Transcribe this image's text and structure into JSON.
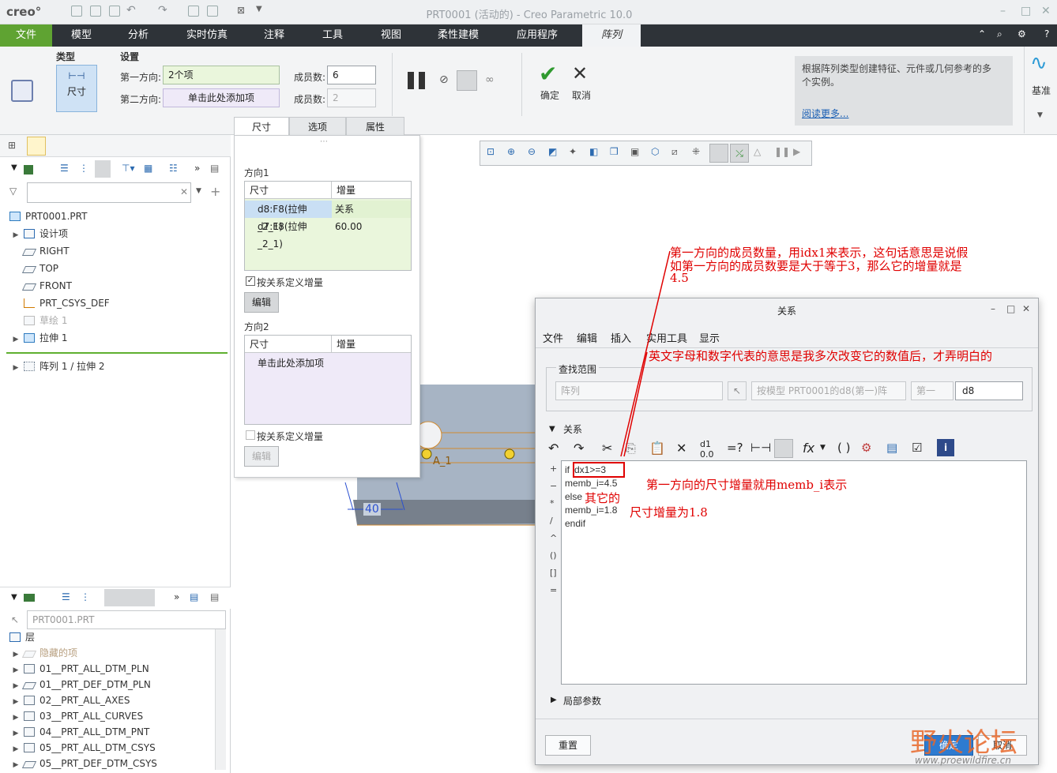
{
  "window": {
    "logo": "creo°",
    "title": "PRT0001 (活动的) - Creo Parametric 10.0"
  },
  "menu": [
    "文件",
    "模型",
    "分析",
    "实时仿真",
    "注释",
    "工具",
    "视图",
    "柔性建模",
    "应用程序",
    "阵列"
  ],
  "ribbon": {
    "type_group": "类型",
    "type_button": "尺寸",
    "settings_group": "设置",
    "dir1_label": "第一方向:",
    "dir1_value": "2个项",
    "dir2_label": "第二方向:",
    "dir2_value": "单击此处添加项",
    "members1_label": "成员数:",
    "members1_value": "6",
    "members2_label": "成员数:",
    "members2_value": "2",
    "ok_label": "确定",
    "cancel_label": "取消",
    "help_text": "根据阵列类型创建特征、元件或几何参考的多个实例。",
    "help_link": "阅读更多...",
    "datum_label": "基准",
    "tabs": [
      "尺寸",
      "选项",
      "属性"
    ]
  },
  "model_tree": {
    "root": "PRT0001.PRT",
    "items": [
      "设计项",
      "RIGHT",
      "TOP",
      "FRONT",
      "PRT_CSYS_DEF",
      "草绘 1",
      "拉伸 1",
      "阵列 1 / 拉伸 2"
    ]
  },
  "layer_tree": {
    "selector": "PRT0001.PRT",
    "header": "层",
    "items": [
      "隐藏的项",
      "01__PRT_ALL_DTM_PLN",
      "01__PRT_DEF_DTM_PLN",
      "02__PRT_ALL_AXES",
      "03__PRT_ALL_CURVES",
      "04__PRT_ALL_DTM_PNT",
      "05__PRT_ALL_DTM_CSYS",
      "05__PRT_DEF_DTM_CSYS"
    ]
  },
  "dim_panel": {
    "dir1_title": "方向1",
    "col_dim": "尺寸",
    "col_inc": "增量",
    "rows": [
      {
        "dim": "d8:F8(拉伸_2_1)",
        "inc": "关系"
      },
      {
        "dim": "d7:F8(拉伸_2_1)",
        "inc": "60.00"
      }
    ],
    "checkbox1": "按关系定义增量",
    "edit1": "编辑",
    "dir2_title": "方向2",
    "col_dim2": "尺寸",
    "col_inc2": "增量",
    "placeholder2": "单击此处添加项",
    "checkbox2": "按关系定义增量",
    "edit2": "编辑"
  },
  "model_labels": {
    "dim": "40",
    "axis": "A_1"
  },
  "relations": {
    "title": "关系",
    "menu": [
      "文件",
      "编辑",
      "插入",
      "实用工具",
      "显示"
    ],
    "scope_label": "查找范围",
    "scope_type": "阵列",
    "scope_ref": "按模型 PRT0001的d8(第一)阵",
    "scope_dir": "第一",
    "scope_dim": "d8",
    "section": "关系",
    "side_symbols": [
      "+",
      "−",
      "*",
      "/",
      "^",
      "()",
      "[]",
      "="
    ],
    "code": [
      "if  idx1>=3",
      "memb_i=4.5",
      "else",
      "memb_i=1.8",
      "endif"
    ],
    "local_params": "局部参数",
    "reset": "重置",
    "ok": "确定",
    "cancel": "取消"
  },
  "annotations": {
    "a1": "第一方向的成员数量，用idx1来表示，这句话意思是说假",
    "a2": "如第一方向的成员数要是大于等于3，那么它的增量就是",
    "a3": "4.5",
    "a4": "英文字母和数字代表的意思是我多次改变它的数值后，才弄明白的",
    "a5": "第一方向的尺寸增量就用memb_i表示",
    "a6": "其它的",
    "a7": "尺寸增量为1.8"
  },
  "watermark": {
    "brand": "野火论坛",
    "url": "www.proewildfire.cn"
  },
  "colors": {
    "accent": "#5fa332",
    "menubar": "#2e3338",
    "annotation": "#e00000"
  }
}
